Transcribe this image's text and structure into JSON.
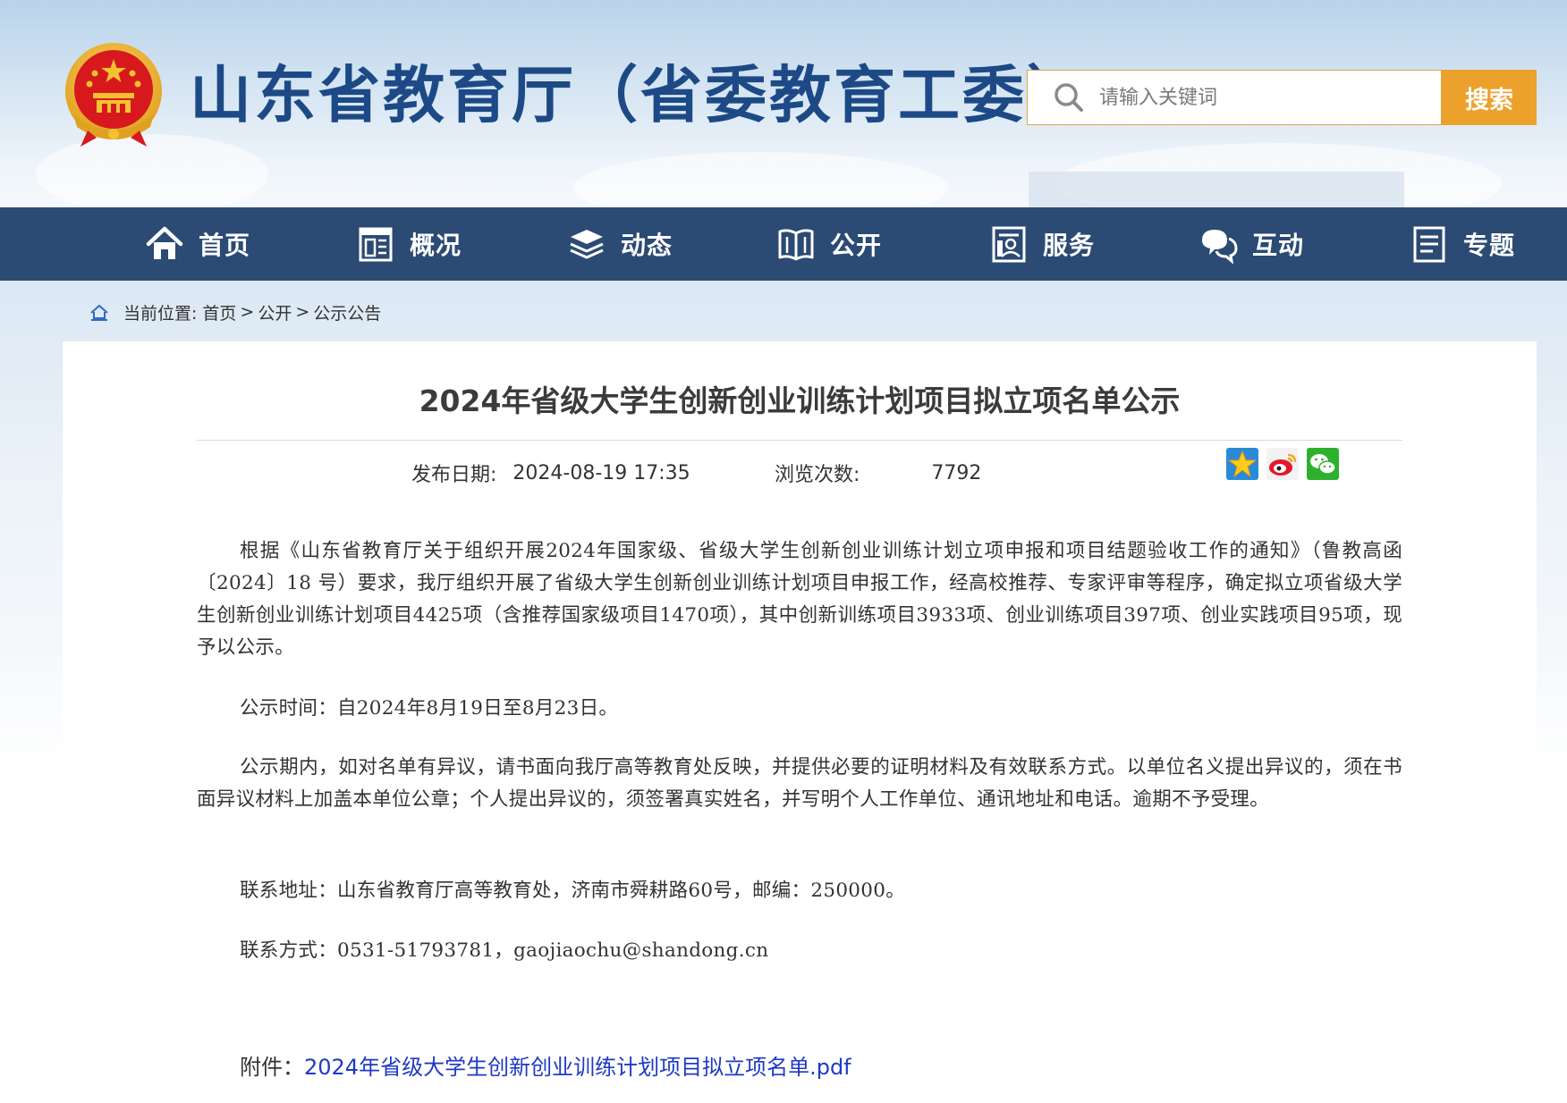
{
  "header": {
    "site_title": "山东省教育厅（省委教育工委）",
    "search_placeholder": "请输入关键词",
    "search_button": "搜索"
  },
  "nav": {
    "items": [
      {
        "label": "首页",
        "icon": "home-icon"
      },
      {
        "label": "概况",
        "icon": "building-icon"
      },
      {
        "label": "动态",
        "icon": "layers-icon"
      },
      {
        "label": "公开",
        "icon": "open-book-icon"
      },
      {
        "label": "服务",
        "icon": "service-document-icon"
      },
      {
        "label": "互动",
        "icon": "chat-bubbles-icon"
      },
      {
        "label": "专题",
        "icon": "topic-document-icon"
      }
    ]
  },
  "breadcrumb": {
    "prefix": "当前位置:",
    "items": [
      "首页",
      "公开",
      "公示公告"
    ],
    "separator": ">"
  },
  "article": {
    "title": "2024年省级大学生创新创业训练计划项目拟立项名单公示",
    "date_label": "发布日期:",
    "date_value": "2024-08-19 17:35",
    "views_label": "浏览次数:",
    "views_value": "7792",
    "share_icons": [
      "favorite-star-icon",
      "weibo-icon",
      "wechat-icon"
    ],
    "paragraphs": [
      "根据《山东省教育厅关于组织开展2024年国家级、省级大学生创新创业训练计划立项申报和项目结题验收工作的通知》（鲁教高函〔2024〕18 号）要求，我厅组织开展了省级大学生创新创业训练计划项目申报工作，经高校推荐、专家评审等程序，确定拟立项省级大学生创新创业训练计划项目4425项（含推荐国家级项目1470项），其中创新训练项目3933项、创业训练项目397项、创业实践项目95项，现予以公示。",
      "公示时间：自2024年8月19日至8月23日。",
      "公示期内，如对名单有异议，请书面向我厅高等教育处反映，并提供必要的证明材料及有效联系方式。以单位名义提出异议的，须在书面异议材料上加盖本单位公章；个人提出异议的，须签署真实姓名，并写明个人工作单位、通讯地址和电话。逾期不予受理。",
      "联系地址：山东省教育厅高等教育处，济南市舜耕路60号，邮编：250000。",
      "联系方式：0531-51793781，gaojiaochu@shandong.cn"
    ],
    "attachment_label": "附件：",
    "attachment_link": "2024年省级大学生创新创业训练计划项目拟立项名单.pdf"
  },
  "colors": {
    "title_blue": "#1d4a86",
    "nav_bg": "#2b4a74",
    "search_button": "#eca12c",
    "link_blue": "#1f39c6",
    "emblem_red": "#d7191d",
    "emblem_gold": "#f3b82a"
  }
}
